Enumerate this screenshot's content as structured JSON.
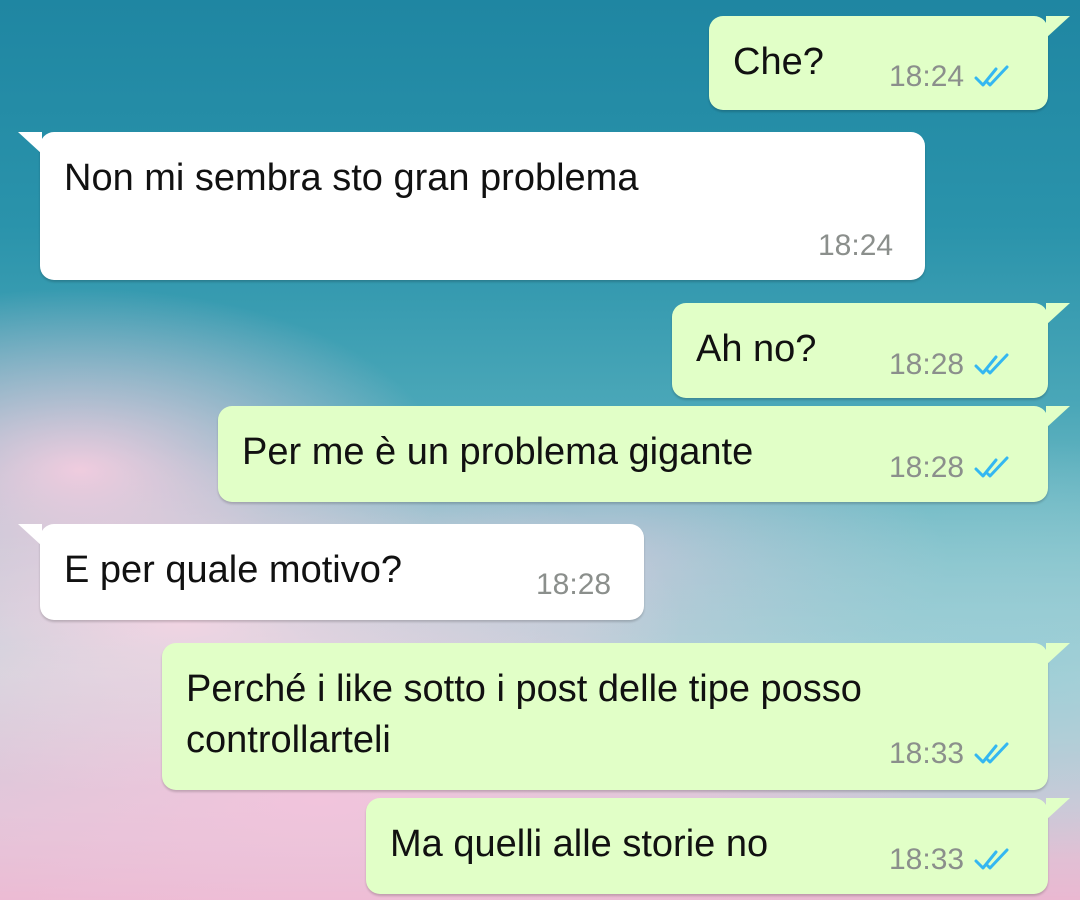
{
  "colors": {
    "outgoing_bubble": "#e1ffc7",
    "incoming_bubble": "#ffffff",
    "read_ticks": "#34b7f1",
    "timestamp": "#8b8f8c"
  },
  "messages": [
    {
      "direction": "outgoing",
      "lines": [
        "Che?"
      ],
      "time": "18:24",
      "status_icon": "double-check-read-icon"
    },
    {
      "direction": "incoming",
      "lines": [
        "Non mi sembra sto gran problema"
      ],
      "time": "18:24"
    },
    {
      "direction": "outgoing",
      "lines": [
        "Ah no?"
      ],
      "time": "18:28",
      "status_icon": "double-check-read-icon"
    },
    {
      "direction": "outgoing",
      "lines": [
        "Per me è un problema gigante"
      ],
      "time": "18:28",
      "status_icon": "double-check-read-icon"
    },
    {
      "direction": "incoming",
      "lines": [
        "E per quale motivo?"
      ],
      "time": "18:28"
    },
    {
      "direction": "outgoing",
      "lines": [
        "Perché i like sotto i post delle tipe posso",
        "controllarteli"
      ],
      "time": "18:33",
      "status_icon": "double-check-read-icon"
    },
    {
      "direction": "outgoing",
      "lines": [
        "Ma quelli alle storie no"
      ],
      "time": "18:33",
      "status_icon": "double-check-read-icon"
    }
  ]
}
